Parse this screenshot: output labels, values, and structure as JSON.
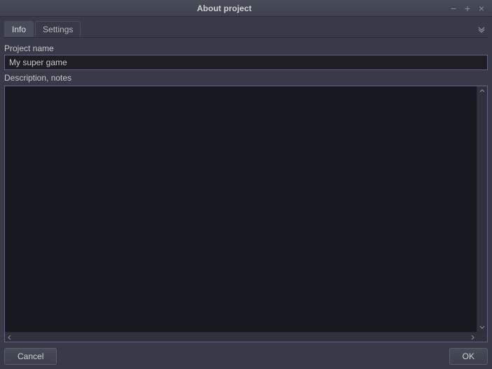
{
  "window": {
    "title": "About project"
  },
  "tabs": {
    "info": "Info",
    "settings": "Settings"
  },
  "form": {
    "project_name_label": "Project name",
    "project_name_value": "My super game",
    "description_label": "Description, notes",
    "description_value": ""
  },
  "buttons": {
    "cancel": "Cancel",
    "ok": "OK"
  }
}
